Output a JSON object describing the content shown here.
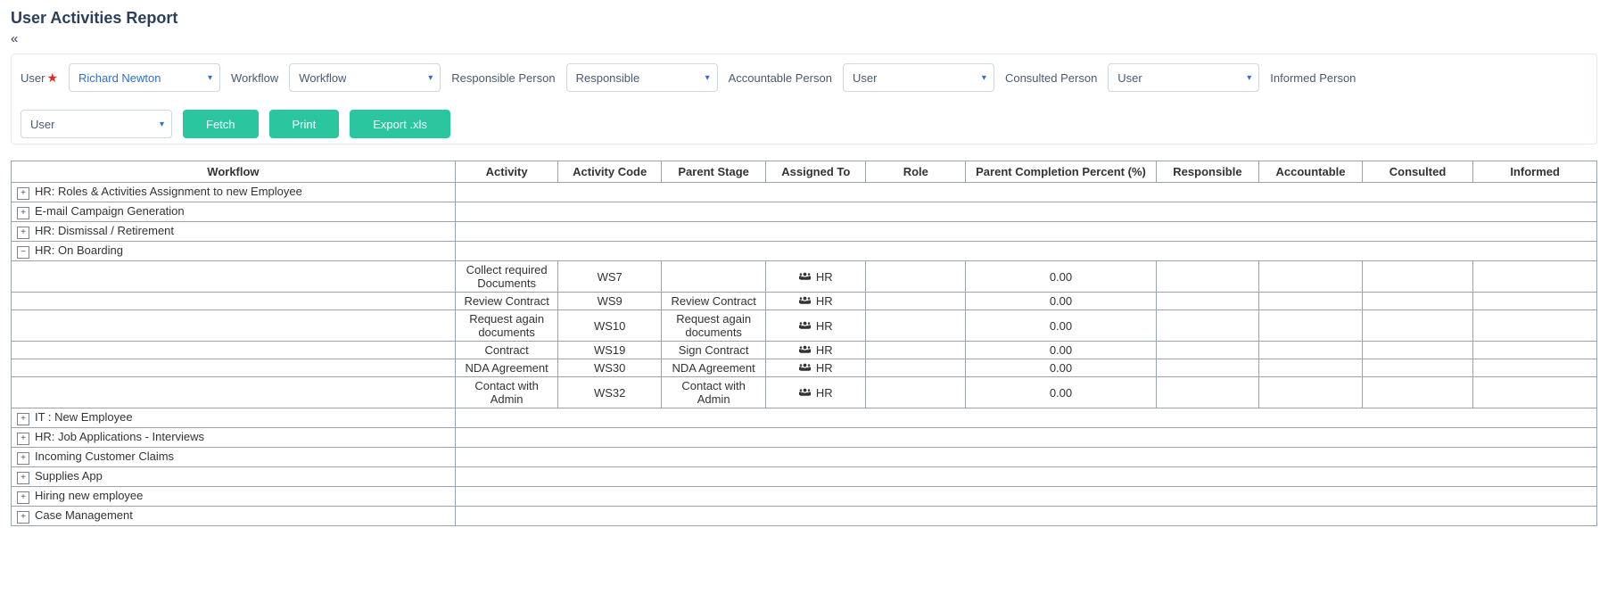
{
  "title": "User Activities Report",
  "filters": {
    "user_label": "User",
    "user_value": "Richard Newton",
    "workflow_label": "Workflow",
    "workflow_value": "Workflow",
    "responsible_label": "Responsible Person",
    "responsible_value": "Responsible",
    "accountable_label": "Accountable Person",
    "accountable_value": "User",
    "consulted_label": "Consulted Person",
    "consulted_value": "User",
    "informed_label": "Informed Person",
    "informed_value": "User"
  },
  "buttons": {
    "fetch": "Fetch",
    "print": "Print",
    "export": "Export .xls"
  },
  "columns": {
    "workflow": "Workflow",
    "activity": "Activity",
    "activity_code": "Activity Code",
    "parent_stage": "Parent Stage",
    "assigned_to": "Assigned To",
    "role": "Role",
    "pcp": "Parent Completion Percent (%)",
    "responsible": "Responsible",
    "accountable": "Accountable",
    "consulted": "Consulted",
    "informed": "Informed"
  },
  "groups": [
    {
      "expand": "+",
      "label": "HR: Roles & Activities Assignment to new Employee"
    },
    {
      "expand": "+",
      "label": "E-mail Campaign Generation"
    },
    {
      "expand": "+",
      "label": "HR: Dismissal / Retirement"
    },
    {
      "expand": "−",
      "label": "HR: On Boarding",
      "rows": [
        {
          "activity": "Collect required Documents",
          "code": "WS7",
          "parent_stage": "",
          "assigned": "HR",
          "pcp": "0.00"
        },
        {
          "activity": "Review Contract",
          "code": "WS9",
          "parent_stage": "Review Contract",
          "assigned": "HR",
          "pcp": "0.00"
        },
        {
          "activity": "Request again documents",
          "code": "WS10",
          "parent_stage": "Request again documents",
          "assigned": "HR",
          "pcp": "0.00"
        },
        {
          "activity": "Contract",
          "code": "WS19",
          "parent_stage": "Sign Contract",
          "assigned": "HR",
          "pcp": "0.00"
        },
        {
          "activity": "NDA Agreement",
          "code": "WS30",
          "parent_stage": "NDA Agreement",
          "assigned": "HR",
          "pcp": "0.00"
        },
        {
          "activity": "Contact with Admin",
          "code": "WS32",
          "parent_stage": "Contact with Admin",
          "assigned": "HR",
          "pcp": "0.00"
        }
      ]
    },
    {
      "expand": "+",
      "label": "IT : New Employee"
    },
    {
      "expand": "+",
      "label": "HR: Job Applications - Interviews"
    },
    {
      "expand": "+",
      "label": "Incoming Customer Claims"
    },
    {
      "expand": "+",
      "label": "Supplies App"
    },
    {
      "expand": "+",
      "label": "Hiring new employee"
    },
    {
      "expand": "+",
      "label": "Case Management"
    }
  ]
}
